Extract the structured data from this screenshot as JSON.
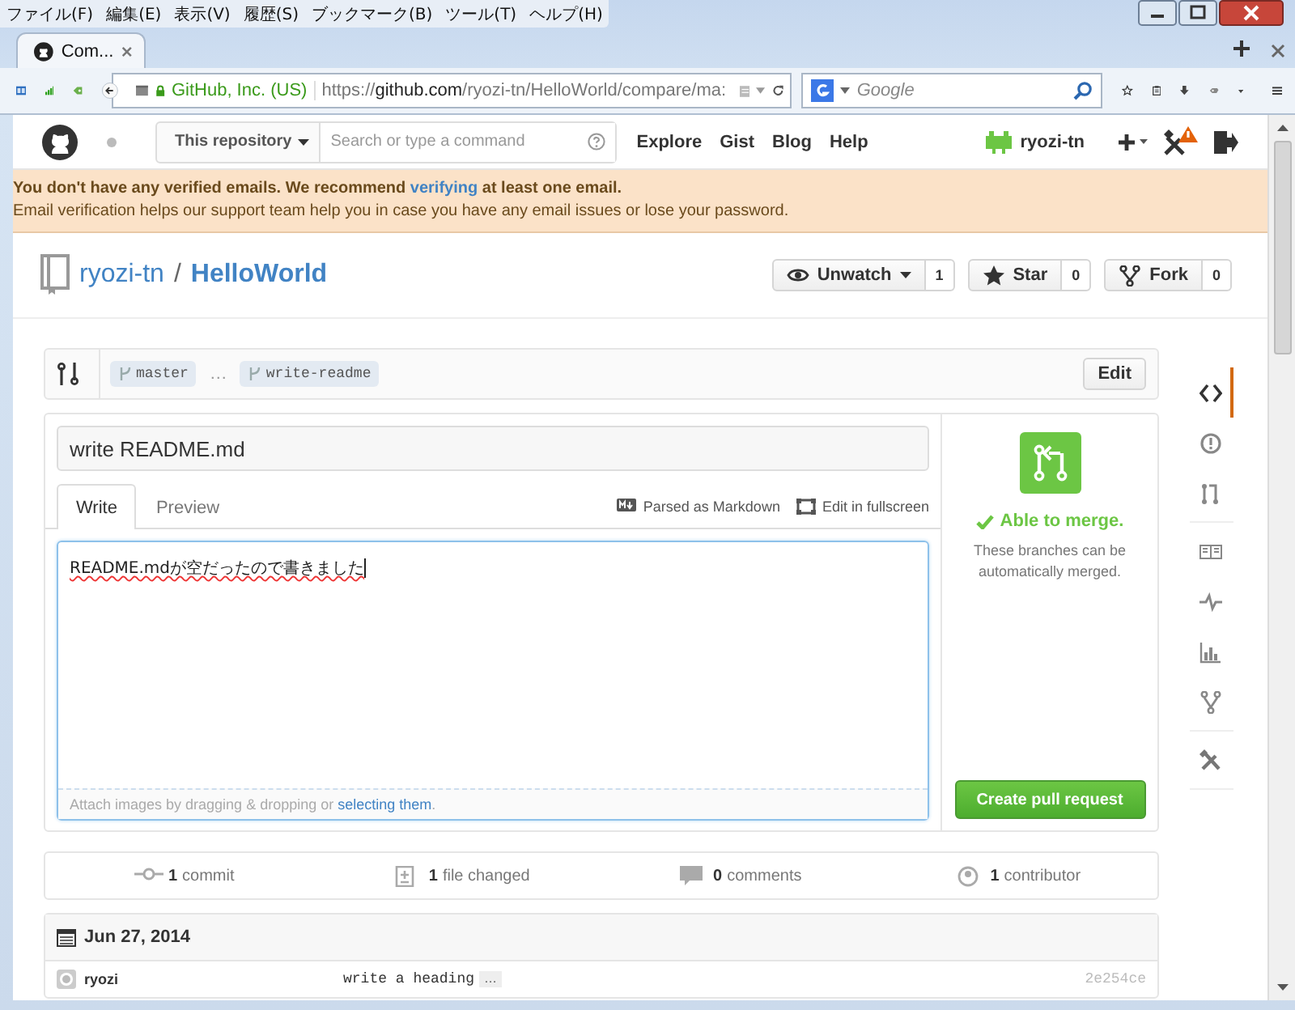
{
  "menu_bar": [
    "ファイル(F)",
    "編集(E)",
    "表示(V)",
    "履歴(S)",
    "ブックマーク(B)",
    "ツール(T)",
    "ヘルプ(H)"
  ],
  "browser_tab": {
    "title": "Com..."
  },
  "address_bar": {
    "identity": "GitHub, Inc. (US)",
    "url_scheme": "https://",
    "url_host": "github.com",
    "url_path": "/ryozi-tn/HelloWorld/compare/ma:"
  },
  "web_search": {
    "placeholder": "Google"
  },
  "site_header": {
    "scope": "This repository",
    "search_placeholder": "Search or type a command",
    "nav": [
      "Explore",
      "Gist",
      "Blog",
      "Help"
    ],
    "user": "ryozi-tn"
  },
  "banner": {
    "before": "You don't have any verified emails. We recommend ",
    "link": "verifying",
    "after": " at least one email.",
    "detail": "Email verification helps our support team help you in case you have any email issues or lose your password."
  },
  "repo": {
    "owner": "ryozi-tn",
    "separator": "/",
    "name": "HelloWorld",
    "actions": [
      {
        "label": "Unwatch",
        "count": "1",
        "dropdown": true
      },
      {
        "label": "Star",
        "count": "0",
        "dropdown": false
      },
      {
        "label": "Fork",
        "count": "0",
        "dropdown": false
      }
    ]
  },
  "compare": {
    "base": "master",
    "separator": "…",
    "head": "write-readme",
    "edit": "Edit"
  },
  "pull_form": {
    "title": "write README.md",
    "tabs": [
      {
        "label": "Write",
        "selected": true
      },
      {
        "label": "Preview",
        "selected": false
      }
    ],
    "hints": [
      "Parsed as Markdown",
      "Edit in fullscreen"
    ],
    "body": "README.mdが空だったので書きました",
    "attach_text": "Attach images by dragging & dropping or ",
    "attach_link": "selecting them",
    "attach_end": "."
  },
  "merge": {
    "status": "Able to merge.",
    "note": "These branches can be automatically merged.",
    "button": "Create pull request"
  },
  "repo_nav": [
    {
      "selected": true
    },
    {
      "selected": false
    },
    {
      "selected": false
    },
    {
      "selected": false
    },
    {
      "selected": false
    },
    {
      "selected": false
    },
    {
      "selected": false
    },
    {
      "selected": false
    }
  ],
  "stats": [
    {
      "count": "1",
      "label": "commit"
    },
    {
      "count": "1",
      "label": "file changed"
    },
    {
      "count": "0",
      "label": "comments"
    },
    {
      "count": "1",
      "label": "contributor"
    }
  ],
  "commits": {
    "date": "Jun 27, 2014",
    "rows": [
      {
        "author": "ryozi",
        "message": "write a heading",
        "more": "…",
        "sha": "2e254ce"
      }
    ]
  }
}
